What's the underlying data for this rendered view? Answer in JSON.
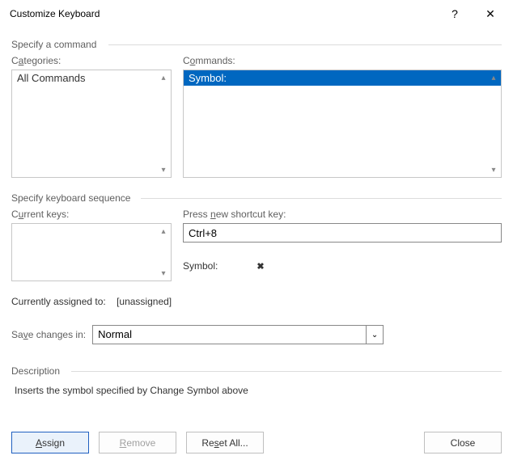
{
  "title": "Customize Keyboard",
  "help": "?",
  "close_glyph": "✕",
  "sections": {
    "specify_command": "Specify a command",
    "specify_sequence": "Specify keyboard sequence",
    "description": "Description"
  },
  "categories": {
    "label_pre": "C",
    "label_u": "a",
    "label_post": "tegories:",
    "items": [
      "All Commands"
    ],
    "selected_index": 0
  },
  "commands": {
    "label_pre": "C",
    "label_u": "o",
    "label_post": "mmands:",
    "items": [
      "Symbol:"
    ],
    "selected_index": 0
  },
  "current_keys": {
    "label_pre": "C",
    "label_u": "u",
    "label_post": "rrent keys:",
    "items": []
  },
  "new_key": {
    "label_pre": "Press ",
    "label_u": "n",
    "label_post": "ew shortcut key:",
    "value": "Ctrl+8"
  },
  "symbol_preview": {
    "label": "Symbol:",
    "glyph": "✖"
  },
  "assigned": {
    "label": "Currently assigned to:",
    "value": "[unassigned]"
  },
  "save_in": {
    "label_pre": "Sa",
    "label_u": "v",
    "label_post": "e changes in:",
    "value": "Normal"
  },
  "description_text": "Inserts the symbol specified by Change Symbol above",
  "buttons": {
    "assign_pre": "",
    "assign_u": "A",
    "assign_post": "ssign",
    "remove_pre": "",
    "remove_u": "R",
    "remove_post": "emove",
    "reset_pre": "Re",
    "reset_u": "s",
    "reset_post": "et All...",
    "close": "Close"
  },
  "scroll": {
    "up": "▴",
    "down": "▾",
    "sel": "⌄"
  }
}
